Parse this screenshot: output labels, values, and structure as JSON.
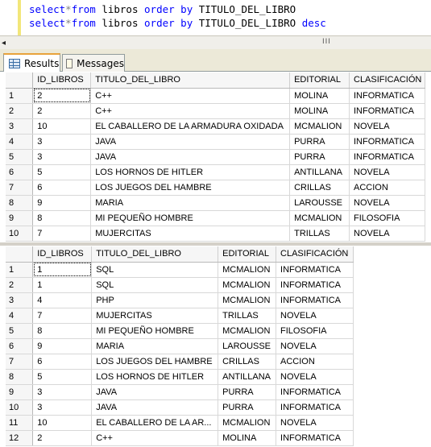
{
  "editor": {
    "line1": {
      "kw1": "select",
      "op": "*",
      "kw2": "from",
      "rest": " libros ",
      "kw3": "order by",
      "col": " TITULO_DEL_LIBRO",
      "kw4": ""
    },
    "line2": {
      "kw1": "select",
      "op": "*",
      "kw2": "from",
      "rest": " libros ",
      "kw3": "order by",
      "col": " TITULO_DEL_LIBRO ",
      "kw4": "desc"
    }
  },
  "scroll": {
    "grip": "III"
  },
  "tabs": [
    {
      "label": "Results",
      "icon": "grid-icon",
      "active": true
    },
    {
      "label": "Messages",
      "icon": "messages-icon",
      "active": false
    }
  ],
  "result1": {
    "columns": [
      "ID_LIBROS",
      "TITULO_DEL_LIBRO",
      "EDITORIAL",
      "CLASIFICACIÓN"
    ],
    "rows": [
      [
        "1",
        "2",
        "C++",
        "MOLINA",
        "INFORMATICA"
      ],
      [
        "2",
        "2",
        "C++",
        "MOLINA",
        "INFORMATICA"
      ],
      [
        "3",
        "10",
        "EL CABALLERO DE LA ARMADURA OXIDADA",
        "MCMALION",
        "NOVELA"
      ],
      [
        "4",
        "3",
        "JAVA",
        "PURRA",
        "INFORMATICA"
      ],
      [
        "5",
        "3",
        "JAVA",
        "PURRA",
        "INFORMATICA"
      ],
      [
        "6",
        "5",
        "LOS HORNOS DE HITLER",
        "ANTILLANA",
        "NOVELA"
      ],
      [
        "7",
        "6",
        "LOS JUEGOS DEL HAMBRE",
        "CRILLAS",
        "ACCION"
      ],
      [
        "8",
        "9",
        "MARIA",
        "LAROUSSE",
        "NOVELA"
      ],
      [
        "9",
        "8",
        "MI PEQUEÑO HOMBRE",
        "MCMALION",
        "FILOSOFIA"
      ],
      [
        "10",
        "7",
        "MUJERCITAS",
        "TRILLAS",
        "NOVELA"
      ]
    ]
  },
  "result2": {
    "columns": [
      "ID_LIBROS",
      "TITULO_DEL_LIBRO",
      "EDITORIAL",
      "CLASIFICACIÓN"
    ],
    "rows": [
      [
        "1",
        "1",
        "SQL",
        "MCMALION",
        "INFORMATICA"
      ],
      [
        "2",
        "1",
        "SQL",
        "MCMALION",
        "INFORMATICA"
      ],
      [
        "3",
        "4",
        "PHP",
        "MCMALION",
        "INFORMATICA"
      ],
      [
        "4",
        "7",
        "MUJERCITAS",
        "TRILLAS",
        "NOVELA"
      ],
      [
        "5",
        "8",
        "MI PEQUEÑO HOMBRE",
        "MCMALION",
        "FILOSOFIA"
      ],
      [
        "6",
        "9",
        "MARIA",
        "LAROUSSE",
        "NOVELA"
      ],
      [
        "7",
        "6",
        "LOS JUEGOS DEL HAMBRE",
        "CRILLAS",
        "ACCION"
      ],
      [
        "8",
        "5",
        "LOS HORNOS DE HITLER",
        "ANTILLANA",
        "NOVELA"
      ],
      [
        "9",
        "3",
        "JAVA",
        "PURRA",
        "INFORMATICA"
      ],
      [
        "10",
        "3",
        "JAVA",
        "PURRA",
        "INFORMATICA"
      ],
      [
        "11",
        "10",
        "EL CABALLERO DE LA AR...",
        "MCMALION",
        "NOVELA"
      ],
      [
        "12",
        "2",
        "C++",
        "MOLINA",
        "INFORMATICA"
      ]
    ]
  }
}
